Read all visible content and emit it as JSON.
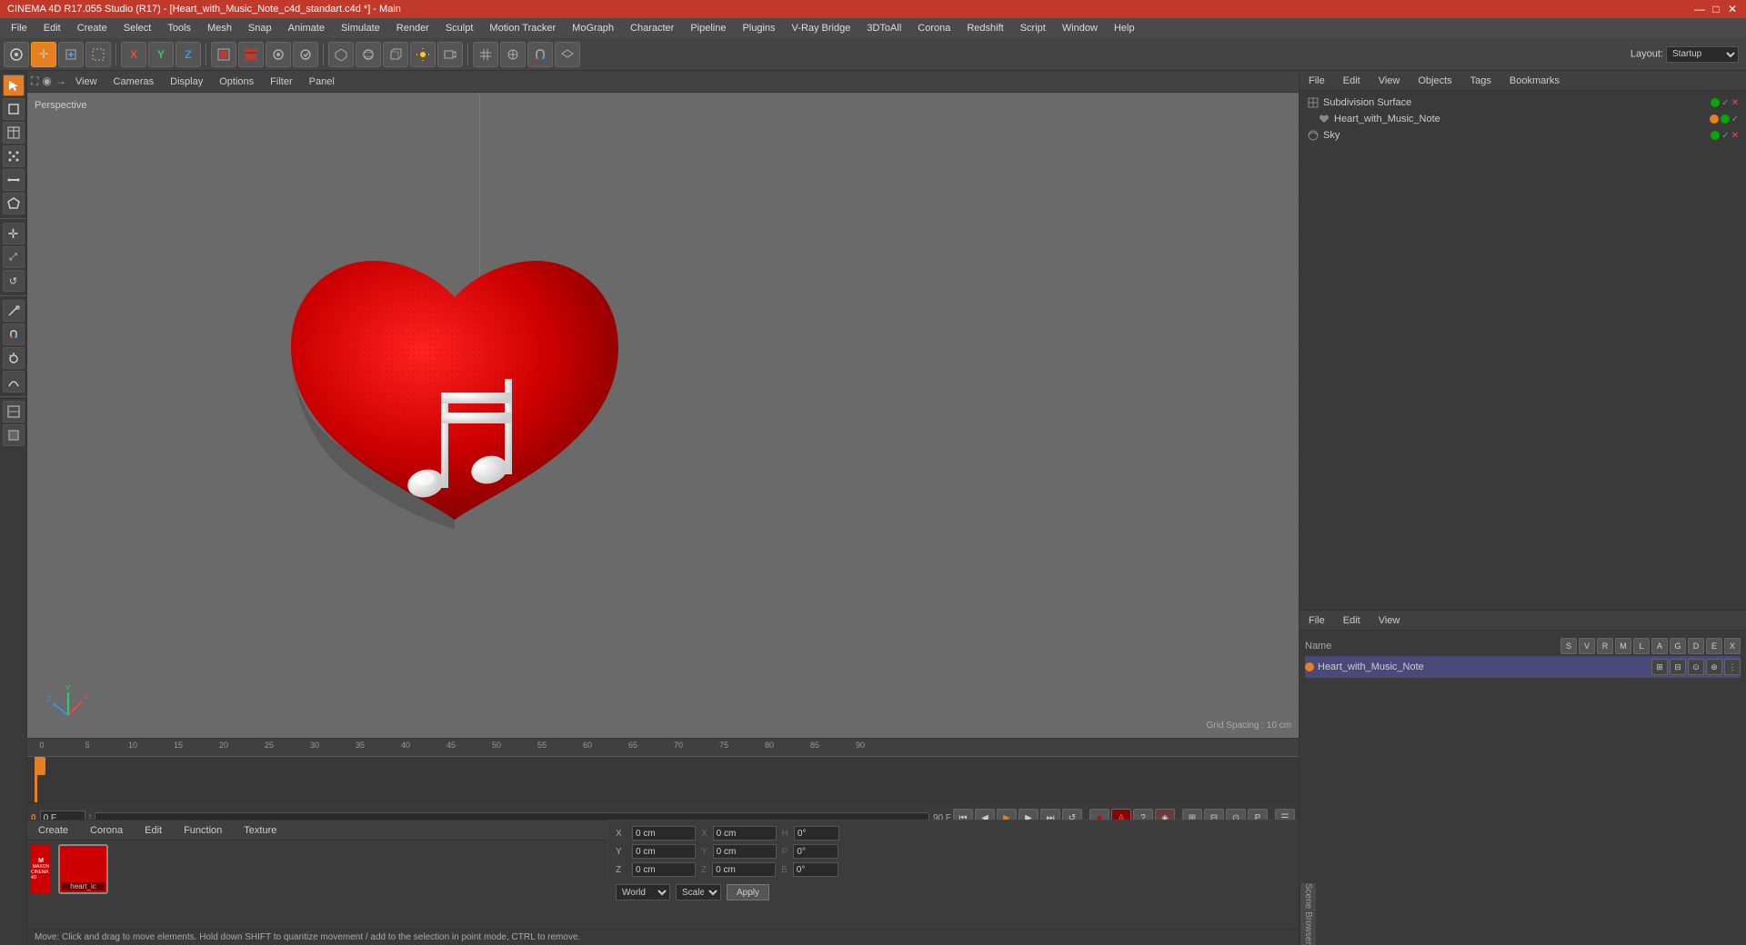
{
  "titlebar": {
    "title": "CINEMA 4D R17.055 Studio (R17) - [Heart_with_Music_Note_c4d_standart.c4d *] - Main",
    "minimize": "—",
    "maximize": "□",
    "close": "✕"
  },
  "menubar": {
    "items": [
      "File",
      "Edit",
      "Create",
      "Select",
      "Tools",
      "Mesh",
      "Snap",
      "Animate",
      "Simulate",
      "Render",
      "Sculpt",
      "Motion Tracker",
      "MoGraph",
      "Character",
      "Pipeline",
      "Plugins",
      "V-Ray Bridge",
      "3DToAll",
      "Corona",
      "Redshift",
      "Script",
      "Window",
      "Help"
    ]
  },
  "layout": {
    "label": "Layout:",
    "value": "Startup"
  },
  "viewport": {
    "perspective_label": "Perspective",
    "grid_spacing": "Grid Spacing : 10 cm",
    "view_menu": [
      "View",
      "Cameras",
      "Display",
      "Options",
      "Filter",
      "Panel"
    ]
  },
  "objects_panel": {
    "title": "Objects",
    "menus": [
      "File",
      "Edit",
      "View",
      "Objects",
      "Tags",
      "Bookmarks"
    ],
    "items": [
      {
        "name": "Subdivision Surface",
        "type": "subdivision",
        "indent": 0,
        "badges": [
          "green-check",
          "x"
        ]
      },
      {
        "name": "Heart_with_Music_Note",
        "type": "mesh",
        "indent": 1,
        "badges": [
          "orange-dot",
          "green-check"
        ]
      },
      {
        "name": "Sky",
        "type": "sky",
        "indent": 0,
        "badges": [
          "green-check",
          "x"
        ]
      }
    ]
  },
  "attributes_panel": {
    "menus": [
      "File",
      "Edit",
      "View"
    ],
    "name_label": "Name",
    "columns": [
      "S",
      "V",
      "R",
      "M",
      "L",
      "A",
      "G",
      "D",
      "E",
      "X"
    ],
    "selected_name": "Heart_with_Music_Note",
    "coords": {
      "x_pos": "0 cm",
      "y_pos": "0 cm",
      "z_pos": "0 cm",
      "x_rot": "0 cm",
      "y_rot": "0 cm",
      "z_rot": "0 cm",
      "h": "0°",
      "p": "0°",
      "b": "0°"
    },
    "mode": "World",
    "scale_label": "Scale",
    "apply_label": "Apply"
  },
  "timeline": {
    "current_frame": "0 F",
    "end_frame": "90 F",
    "frame_input": "f",
    "markers": [
      0,
      5,
      10,
      15,
      20,
      25,
      30,
      35,
      40,
      45,
      50,
      55,
      60,
      65,
      70,
      75,
      80,
      85,
      90
    ]
  },
  "material_panel": {
    "menus": [
      "Create",
      "Corona",
      "Edit",
      "Function",
      "Texture"
    ],
    "items": [
      {
        "name": "heart_ic",
        "type": "material",
        "color": "#cc0000"
      }
    ]
  },
  "status_bar": {
    "message": "Move: Click and drag to move elements. Hold down SHIFT to quantize movement / add to the selection in point mode, CTRL to remove."
  },
  "icons": {
    "undo": "↩",
    "redo": "↪",
    "new": "📄",
    "select": "▶",
    "move": "✛",
    "rotate": "↺",
    "scale": "⤢",
    "x_axis": "X",
    "y_axis": "Y",
    "z_axis": "Z",
    "play": "▶",
    "stop": "■",
    "prev_frame": "◀◀",
    "next_frame": "▶▶",
    "rewind": "⏮",
    "forward": "⏭",
    "record": "⏺"
  }
}
